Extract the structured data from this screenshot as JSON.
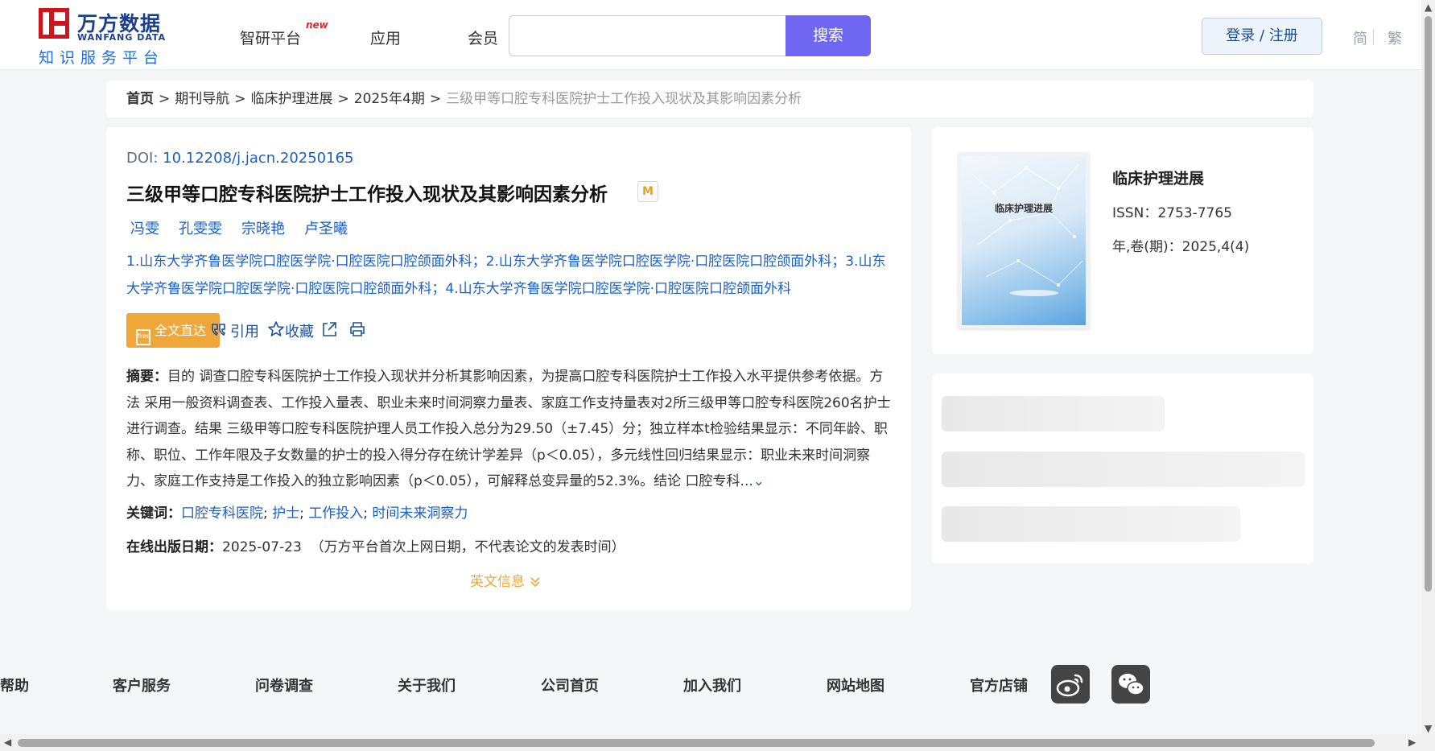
{
  "header": {
    "logo_cn": "万方数据",
    "logo_en": "WANFANG DATA",
    "logo_sub": "知识服务平台",
    "nav": [
      "智研平台",
      "应用",
      "会员"
    ],
    "nav_new_badge": "new",
    "search_placeholder": "",
    "search_button": "搜索",
    "login_button": "登录 / 注册",
    "lang_simplified": "简",
    "lang_traditional": "繁"
  },
  "breadcrumb": {
    "items": [
      "首页",
      "期刊导航",
      "临床护理进展",
      "2025年4期"
    ],
    "separator": ">",
    "current": "三级甲等口腔专科医院护士工作投入现状及其影响因素分析"
  },
  "article": {
    "doi_label": "DOI:",
    "doi": "10.12208/j.jacn.20250165",
    "title": "三级甲等口腔专科医院护士工作投入现状及其影响因素分析",
    "badge": "M",
    "authors": [
      "冯雯",
      "孔雯雯",
      "宗晓艳",
      "卢圣曦"
    ],
    "affiliations": "1.山东大学齐鲁医学院口腔医学院·口腔医院口腔颌面外科；2.山东大学齐鲁医学院口腔医学院·口腔医院口腔颌面外科；3.山东大学齐鲁医学院口腔医学院·口腔医院口腔颌面外科；4.山东大学齐鲁医学院口腔医学院·口腔医院口腔颌面外科",
    "fulltext_button": "全文直达",
    "fulltext_icon_text": "free",
    "actions": {
      "cite": "引用",
      "favorite": "收藏"
    },
    "abstract_label": "摘要：",
    "abstract": "目的 调查口腔专科医院护士工作投入现状并分析其影响因素，为提高口腔专科医院护士工作投入水平提供参考依据。方法 采用一般资料调查表、工作投入量表、职业未来时间洞察力量表、家庭工作支持量表对2所三级甲等口腔专科医院260名护士进行调查。结果 三级甲等口腔专科医院护理人员工作投入总分为29.50（±7.45）分；独立样本t检验结果显示：不同年龄、职称、职位、工作年限及子女数量的护士的投入得分存在统计学差异（p＜0.05），多元线性回归结果显示：职业未来时间洞察力、家庭工作支持是工作投入的独立影响因素（p＜0.05），可解释总变异量的52.3%。结论 口腔专科...",
    "keywords_label": "关键词：",
    "keywords": [
      "口腔专科医院",
      "护士",
      "工作投入",
      "时间未来洞察力"
    ],
    "pubdate_label": "在线出版日期：",
    "pubdate": "2025-07-23",
    "pubdate_note": "（万方平台首次上网日期，不代表论文的发表时间）",
    "english_info": "英文信息"
  },
  "journal": {
    "name": "临床护理进展",
    "cover_title": "临床护理进展",
    "issn_label": "ISSN：",
    "issn": "2753-7765",
    "volume_label": "年,卷(期)：",
    "volume": "2025,4(4)"
  },
  "footer": {
    "links": [
      "帮助",
      "客户服务",
      "问卷调查",
      "关于我们",
      "公司首页",
      "加入我们",
      "网站地图",
      "官方店铺"
    ],
    "social": [
      "weibo-icon",
      "wechat-icon"
    ]
  },
  "colors": {
    "accent": "#6f67f2",
    "link": "#1a5fc4",
    "fulltext": "#efa73a",
    "logo_red": "#d0141d"
  }
}
